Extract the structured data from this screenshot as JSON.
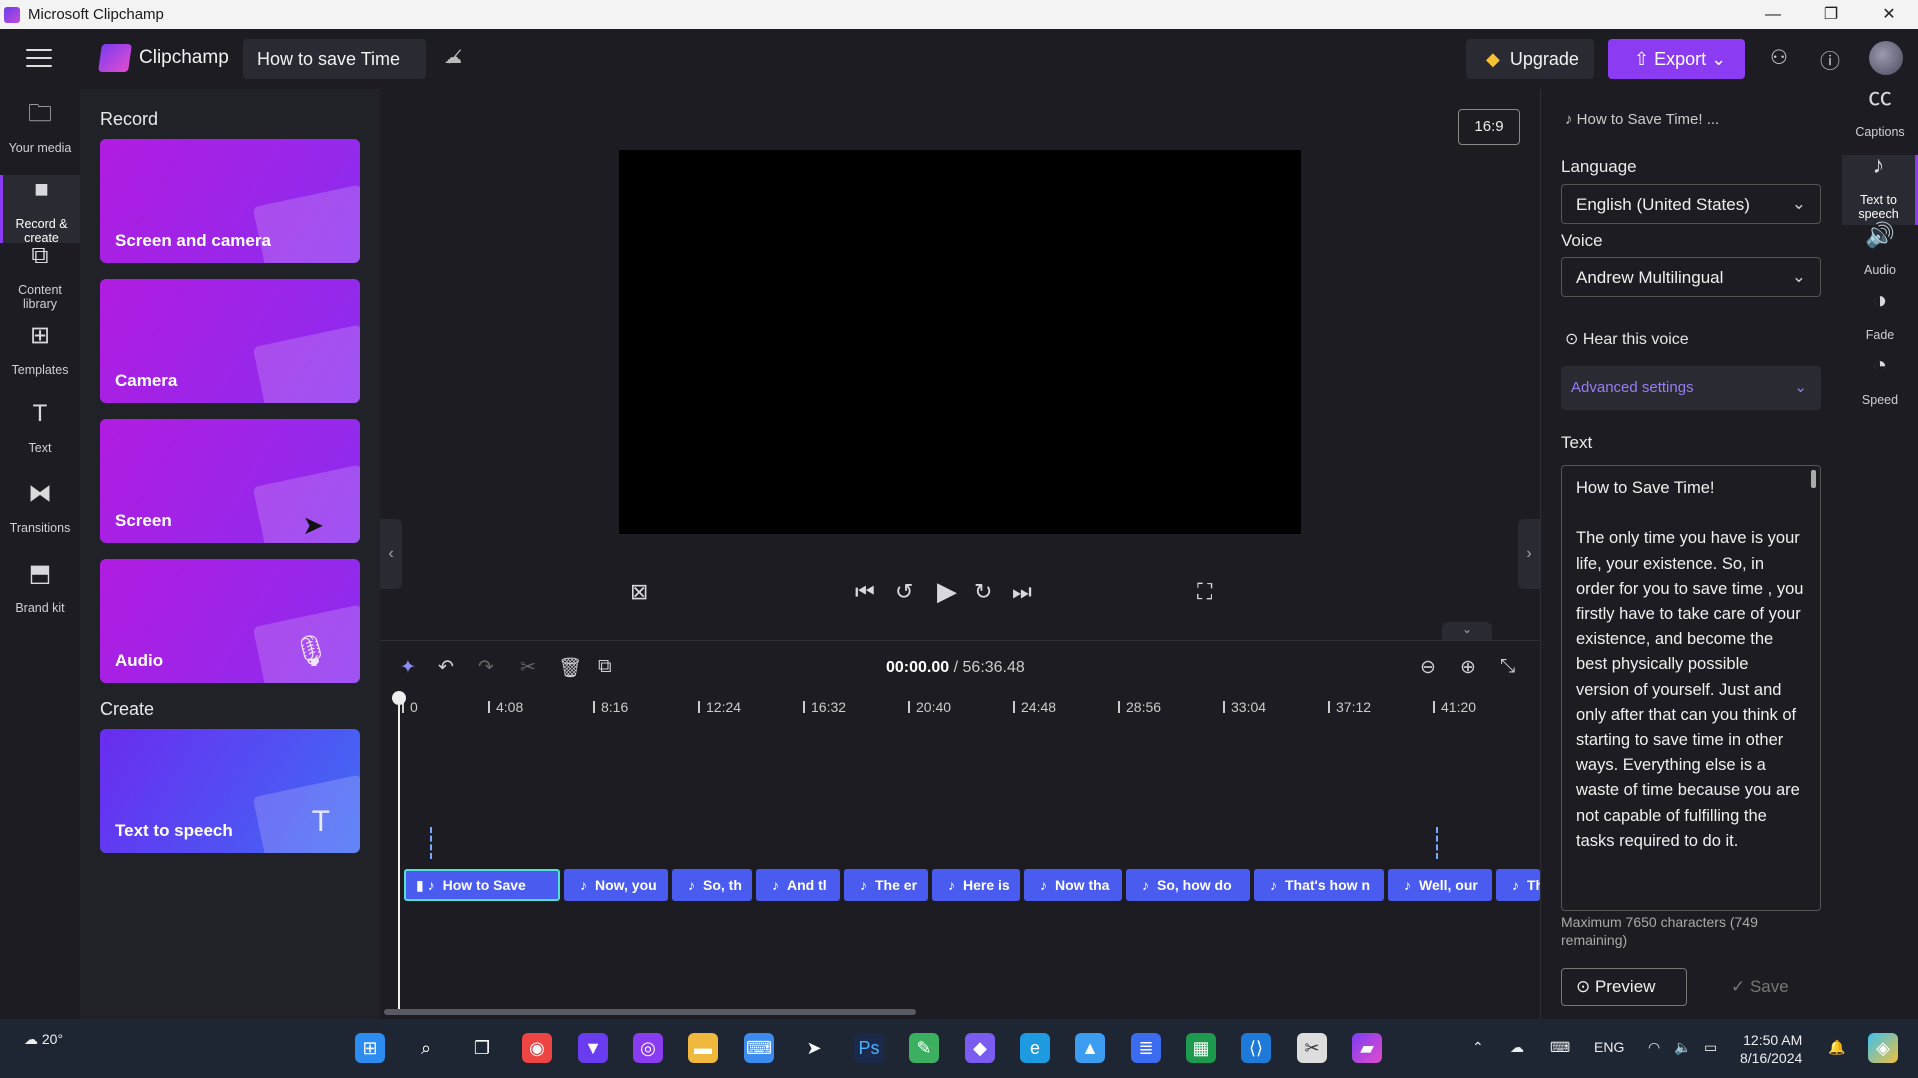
{
  "window": {
    "title": "Microsoft Clipchamp",
    "min": "—",
    "max": "❐",
    "close": "✕"
  },
  "header": {
    "brand": "Clipchamp",
    "project_name": "How to save Time",
    "upgrade": "Upgrade",
    "export": "Export"
  },
  "rail": [
    {
      "label": "Your media",
      "icon": "folder-icon"
    },
    {
      "label": "Record & create",
      "icon": "camera-icon"
    },
    {
      "label": "Content library",
      "icon": "library-icon"
    },
    {
      "label": "Templates",
      "icon": "templates-icon"
    },
    {
      "label": "Text",
      "icon": "text-icon"
    },
    {
      "label": "Transitions",
      "icon": "transitions-icon"
    },
    {
      "label": "Brand kit",
      "icon": "brand-kit-icon"
    }
  ],
  "panel": {
    "record_title": "Record",
    "create_title": "Create",
    "cards": [
      {
        "label": "Screen and camera"
      },
      {
        "label": "Camera"
      },
      {
        "label": "Screen"
      },
      {
        "label": "Audio"
      },
      {
        "label": "Text to speech"
      }
    ]
  },
  "stage": {
    "aspect": "16:9"
  },
  "timeline": {
    "current": "00:00.00",
    "total": "/ 56:36.48",
    "ticks": [
      "0",
      "4:08",
      "8:16",
      "12:24",
      "16:32",
      "20:40",
      "24:48",
      "28:56",
      "33:04",
      "37:12",
      "41:20"
    ],
    "clips": [
      "How to Save",
      "Now, you",
      "So, th",
      "And tl",
      "The er",
      "Here is",
      "Now tha",
      "So, how do",
      "That's how n",
      "Well, our",
      "Th"
    ]
  },
  "tts": {
    "title": "How to Save Time! ...",
    "language_label": "Language",
    "language": "English (United States)",
    "voice_label": "Voice",
    "voice": "Andrew Multilingual",
    "hear_voice": "Hear this voice",
    "advanced": "Advanced settings",
    "text_label": "Text",
    "text": "How to Save Time!\n\nThe only time you have is your life, your existence. So, in order for you to save time , you firstly have to take care of your existence, and become the best physically possible version of yourself. Just and only after that can you think of starting to save time in other ways. Everything else is a waste of time because you are not capable of fulfilling the tasks required to do it.",
    "max_chars": "Maximum 7650 characters (749 remaining)",
    "preview": "Preview",
    "save": "Save"
  },
  "frail": [
    {
      "label": "Captions",
      "icon": "captions-icon"
    },
    {
      "label": "Text to speech",
      "icon": "text-to-speech-icon"
    },
    {
      "label": "Audio",
      "icon": "audio-icon"
    },
    {
      "label": "Fade",
      "icon": "fade-icon"
    },
    {
      "label": "Speed",
      "icon": "speed-icon"
    }
  ],
  "taskbar": {
    "weather": "20°",
    "lang": "ENG",
    "time": "12:50 AM",
    "date": "8/16/2024"
  },
  "colors": {
    "accent": "#8b3cf2",
    "clip": "#4a5cf0",
    "selected_clip_border": "#4fe0d8"
  }
}
